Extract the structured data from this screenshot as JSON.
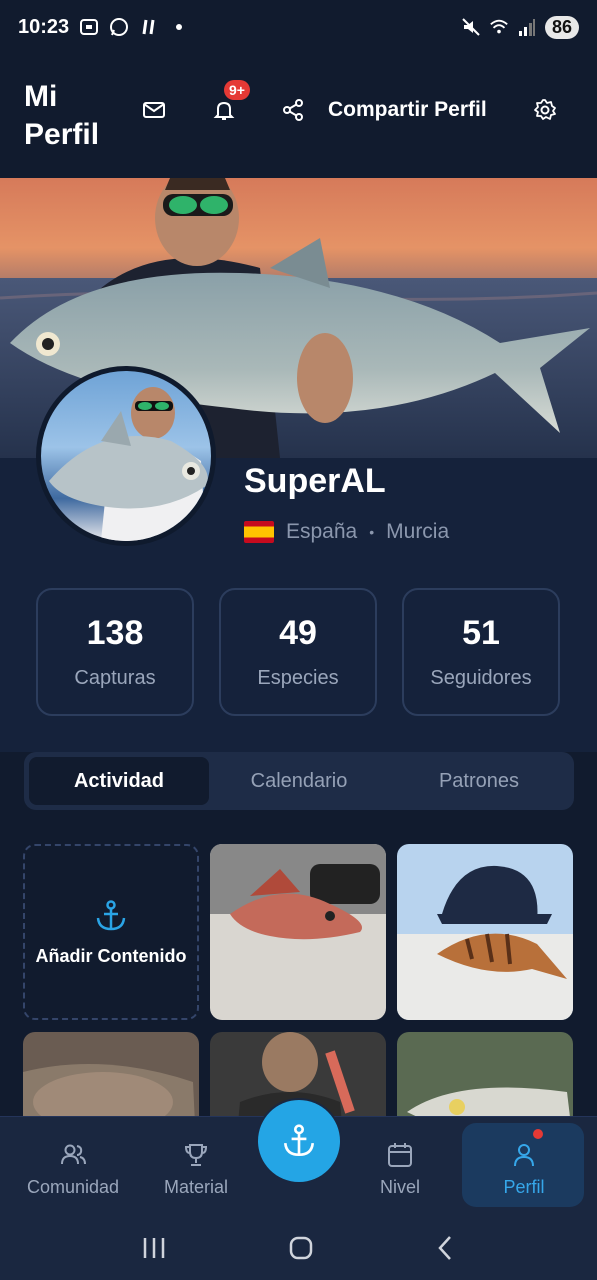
{
  "status_bar": {
    "time": "10:23",
    "battery": "86"
  },
  "header": {
    "title": "Mi Perfil",
    "notification_badge": "9+",
    "share_label": "Compartir Perfil"
  },
  "profile": {
    "username": "SuperAL",
    "country": "España",
    "separator": "•",
    "region": "Murcia"
  },
  "stats": [
    {
      "value": "138",
      "label": "Capturas"
    },
    {
      "value": "49",
      "label": "Especies"
    },
    {
      "value": "51",
      "label": "Seguidores"
    }
  ],
  "tabs": [
    {
      "label": "Actividad",
      "active": true
    },
    {
      "label": "Calendario",
      "active": false
    },
    {
      "label": "Patrones",
      "active": false
    }
  ],
  "grid": {
    "add_label": "Añadir Contenido"
  },
  "bottom_nav": [
    {
      "label": "Comunidad",
      "icon": "users-icon"
    },
    {
      "label": "Material",
      "icon": "trophy-icon"
    },
    {
      "label": "Nivel",
      "icon": "calendar-icon"
    },
    {
      "label": "Perfil",
      "icon": "user-icon",
      "active": true
    }
  ],
  "colors": {
    "background": "#111b2e",
    "accent": "#24a5e5",
    "badge": "#e53935"
  }
}
